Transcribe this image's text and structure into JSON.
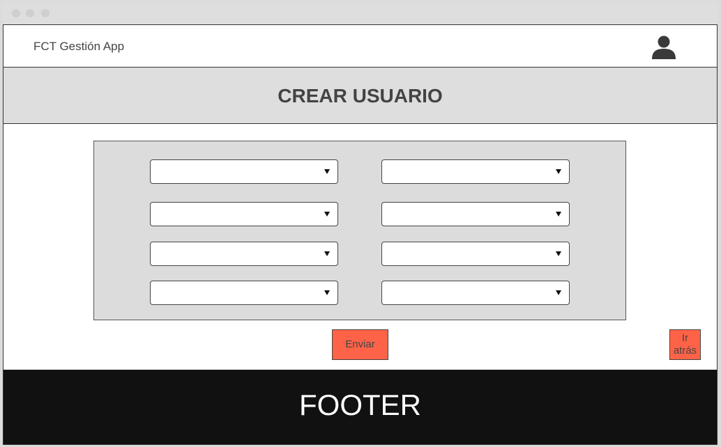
{
  "app": {
    "title": "FCT Gestión App"
  },
  "page": {
    "heading": "CREAR USUARIO"
  },
  "form": {
    "selects": [
      {
        "value": ""
      },
      {
        "value": ""
      },
      {
        "value": ""
      },
      {
        "value": ""
      },
      {
        "value": ""
      },
      {
        "value": ""
      },
      {
        "value": ""
      },
      {
        "value": ""
      }
    ]
  },
  "actions": {
    "send_label": "Enviar",
    "back_label": "Ir atrás"
  },
  "footer": {
    "text": "FOOTER"
  },
  "colors": {
    "accent": "#ff6347",
    "footer_bg": "#111111",
    "band_bg": "#dedede"
  },
  "icons": {
    "user": "user-icon",
    "dropdown": "chevron-down-icon"
  }
}
